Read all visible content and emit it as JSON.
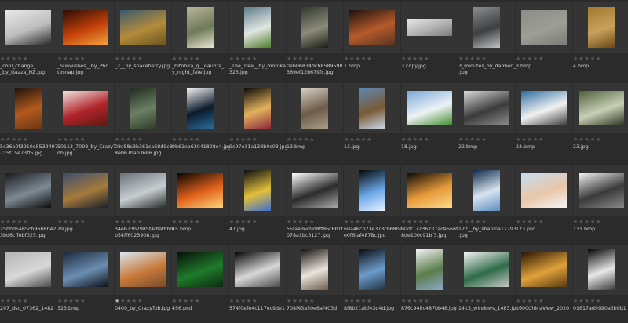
{
  "ui": {
    "accent": "#343434",
    "background": "#2b2b2b",
    "star_empty": "#5a5a5a",
    "star_filled": "#bdbdbd"
  },
  "files": [
    {
      "name": "_cool_change_\n_by_Gazza_NZ.jpg",
      "rating": 0,
      "icon": "tree-silhouette-image",
      "colors": [
        "#e8e8e8",
        "#bdbdbd",
        "#2a2a2a"
      ],
      "thumb_shape": "landscape"
    },
    {
      "name": "_Sunwishes__by_Pho\ntosnap.jpg",
      "rating": 0,
      "icon": "sunset-clouds-image",
      "colors": [
        "#2b0d05",
        "#c4410a",
        "#f3a33a"
      ],
      "thumb_shape": "landscape"
    },
    {
      "name": "_2__by_spaceberry.jpg",
      "rating": 0,
      "icon": "wheat-field-image",
      "colors": [
        "#3b5a6e",
        "#b48b3b",
        "#6a5620"
      ],
      "thumb_shape": "landscape"
    },
    {
      "name": "_hitohira_g__nauhra_\ny_night_fate.jpg",
      "rating": 0,
      "icon": "waterfall-image",
      "colors": [
        "#b9b49a",
        "#6e7a59",
        "#e8e4d0"
      ],
      "thumb_shape": "portrait"
    },
    {
      "name": "_The_Tree__by_moroka\n323.jpg",
      "rating": 0,
      "icon": "lone-tree-image",
      "colors": [
        "#5d7c8a",
        "#e1e6e2",
        "#4f7d2b"
      ],
      "thumb_shape": "portrait"
    },
    {
      "name": "0eb06834dcb8589598\n369ef12b679fc.jpg",
      "rating": 0,
      "icon": "stream-image",
      "colors": [
        "#333a2e",
        "#8c8b7a",
        "#1a1d17"
      ],
      "thumb_shape": "portrait"
    },
    {
      "name": "1.bmp",
      "rating": 0,
      "icon": "dusk-landscape-image",
      "colors": [
        "#1b1210",
        "#b65a2a",
        "#5d3522"
      ],
      "thumb_shape": "landscape"
    },
    {
      "name": "3 copy.jpg",
      "rating": 0,
      "icon": "white-objects-image",
      "colors": [
        "#e9e9e9",
        "#b1b1b1",
        "#7a7a7a"
      ],
      "thumb_shape": "banner"
    },
    {
      "name": "3_minutes_by_damien_c\n.jpg",
      "rating": 0,
      "icon": "clock-tower-image",
      "colors": [
        "#8a8e91",
        "#3c3f40",
        "#c0c3c4"
      ],
      "thumb_shape": "portrait"
    },
    {
      "name": "3.bmp",
      "rating": 0,
      "icon": "grey-texture-image",
      "colors": [
        "#8c8c86",
        "#9e9e98",
        "#7c7c77"
      ],
      "thumb_shape": "landscape"
    },
    {
      "name": "4.bmp",
      "rating": 0,
      "icon": "parchment-image",
      "colors": [
        "#a0782e",
        "#c9a15c",
        "#6b4717"
      ],
      "thumb_shape": "portrait"
    },
    {
      "name": "5c36b0f3910e55324976\n715f15e73ff5.jpg",
      "rating": 0,
      "icon": "violins-image",
      "colors": [
        "#1a120c",
        "#b35a1e",
        "#6d3712"
      ],
      "thumb_shape": "portrait"
    },
    {
      "name": "50112_7098_by_CrazyT\nob.jpg",
      "rating": 0,
      "icon": "red-leaves-image",
      "colors": [
        "#f0e4e0",
        "#b0242a",
        "#5c1a12"
      ],
      "thumb_shape": "landscape"
    },
    {
      "name": "08c58c3b361ca68d9c3\n8e067bab3686.jpg",
      "rating": 0,
      "icon": "green-window-image",
      "colors": [
        "#1e2b1e",
        "#6b8062",
        "#2f3d2a"
      ],
      "thumb_shape": "portrait"
    },
    {
      "name": "9b61ea63041828e4.jpg",
      "rating": 0,
      "icon": "framed-photo-image",
      "colors": [
        "#f4f4f4",
        "#0c1a2a",
        "#2b6c9b"
      ],
      "thumb_shape": "portrait"
    },
    {
      "name": "9c97e31a138b0c03.jpg",
      "rating": 0,
      "icon": "bokeh-lights-image",
      "colors": [
        "#0a0808",
        "#e3b25e",
        "#8c2a3a"
      ],
      "thumb_shape": "portrait"
    },
    {
      "name": "13.bmp",
      "rating": 0,
      "icon": "girl-sitting-image",
      "colors": [
        "#d8d2c2",
        "#6d5b4a",
        "#a99f88"
      ],
      "thumb_shape": "portrait"
    },
    {
      "name": "13.jpg",
      "rating": 0,
      "icon": "wooden-frame-image",
      "colors": [
        "#5e88b4",
        "#7a5a34",
        "#c7d9e8"
      ],
      "thumb_shape": "portrait"
    },
    {
      "name": "18.jpg",
      "rating": 0,
      "icon": "green-hills-image",
      "colors": [
        "#78a8d8",
        "#eef2f6",
        "#3f8a2a"
      ],
      "thumb_shape": "landscape"
    },
    {
      "name": "22.bmp",
      "rating": 0,
      "icon": "pocket-watch-image",
      "colors": [
        "#d9d9d9",
        "#3b3b3b",
        "#8e8e8e"
      ],
      "thumb_shape": "landscape"
    },
    {
      "name": "23.bmp",
      "rating": 0,
      "icon": "teddy-bear-image",
      "colors": [
        "#2b6ca0",
        "#f2f2f2",
        "#3a3a3a"
      ],
      "thumb_shape": "landscape"
    },
    {
      "name": "23.jpg",
      "rating": 0,
      "icon": "forest-path-image",
      "colors": [
        "#4f5e3a",
        "#c7cfb5",
        "#2b3320"
      ],
      "thumb_shape": "landscape"
    },
    {
      "name": "25bbd5a85cb96b8b42\n3bd6cffebf025.jpg",
      "rating": 0,
      "icon": "dark-room-image",
      "colors": [
        "#1a1c1e",
        "#7e8a95",
        "#0d0d0d"
      ],
      "thumb_shape": "landscape"
    },
    {
      "name": "29.jpg",
      "rating": 0,
      "icon": "old-buildings-image",
      "colors": [
        "#3c4e6c",
        "#a57a3c",
        "#1a1f2b"
      ],
      "thumb_shape": "landscape"
    },
    {
      "name": "34eb73b7985f4dfafbbd\nb54ff6025908.jpg",
      "rating": 0,
      "icon": "pyramid-glass-image",
      "colors": [
        "#6a7278",
        "#c8cdd0",
        "#2a2e31"
      ],
      "thumb_shape": "landscape"
    },
    {
      "name": "45.bmp",
      "rating": 0,
      "icon": "fire-night-image",
      "colors": [
        "#0a0503",
        "#e0621b",
        "#ffd27a"
      ],
      "thumb_shape": "landscape"
    },
    {
      "name": "47.jpg",
      "rating": 0,
      "icon": "flowers-dark-image",
      "colors": [
        "#0a0d12",
        "#e2c03a",
        "#3e6ed2"
      ],
      "thumb_shape": "portrait"
    },
    {
      "name": "55faa3ed9d8ff86c6b1f\n078a1bc3127.jpg",
      "rating": 0,
      "icon": "white-figure-image",
      "colors": [
        "#ffffff",
        "#2b2b2b",
        "#a8a8a8"
      ],
      "thumb_shape": "landscape"
    },
    {
      "name": "60a46cb21e373cb68bef\ne0f6faf4878c.jpg",
      "rating": 0,
      "icon": "dandelion-image",
      "colors": [
        "#050608",
        "#6aa8e8",
        "#e8f2ff"
      ],
      "thumb_shape": "portrait"
    },
    {
      "name": "90df17236237ada566f2\n8de100c91bf3.jpg",
      "rating": 0,
      "icon": "window-glow-image",
      "colors": [
        "#0c0906",
        "#e69a3a",
        "#ffd98a"
      ],
      "thumb_shape": "landscape"
    },
    {
      "name": "122__by_shanina12793\n.jpg",
      "rating": 0,
      "icon": "blue-window-image",
      "colors": [
        "#0c2a4a",
        "#d9e4ef",
        "#5b8dbf"
      ],
      "thumb_shape": "portrait"
    },
    {
      "name": "123.psd",
      "rating": 0,
      "icon": "portrait-sky-image",
      "colors": [
        "#c6dcef",
        "#e8c7a8",
        "#f4f4f4"
      ],
      "thumb_shape": "landscape"
    },
    {
      "name": "131.bmp",
      "rating": 0,
      "icon": "butterflies-image",
      "colors": [
        "#f2f2f2",
        "#3a3a3a",
        "#8a8a8a"
      ],
      "thumb_shape": "landscape"
    },
    {
      "name": "297_dsc_07362_1482\n",
      "rating": 0,
      "icon": "stones-water-image",
      "colors": [
        "#b4b4b4",
        "#d8d8d8",
        "#4a4a4a"
      ],
      "thumb_shape": "landscape"
    },
    {
      "name": "323.bmp",
      "rating": 0,
      "icon": "city-night-image",
      "colors": [
        "#1d2a3a",
        "#6b8eb3",
        "#0c0f14"
      ],
      "thumb_shape": "landscape"
    },
    {
      "name": "0409_by_CrazyTob.jpg",
      "rating": 1,
      "icon": "blossom-branch-image",
      "colors": [
        "#d8e6f2",
        "#c87a3a",
        "#7a4a2a"
      ],
      "thumb_shape": "landscape"
    },
    {
      "name": "456.psd",
      "rating": 0,
      "icon": "green-matrix-image",
      "colors": [
        "#071207",
        "#1f7a2a",
        "#0c2b0f"
      ],
      "thumb_shape": "landscape"
    },
    {
      "name": "574f0efe4c117ec9de1\n",
      "rating": 0,
      "icon": "dark-lamps-image",
      "colors": [
        "#060606",
        "#d8d8d8",
        "#4a4a4a"
      ],
      "thumb_shape": "landscape"
    },
    {
      "name": "708f43a50e6af403d\n",
      "rating": 0,
      "icon": "arch-window-image",
      "colors": [
        "#1a1410",
        "#e9e4dc",
        "#6b5a48"
      ],
      "thumb_shape": "portrait"
    },
    {
      "name": "8f8b21abf43d4d.jpg",
      "rating": 0,
      "icon": "gothic-window-image",
      "colors": [
        "#0a0c10",
        "#6c9ccc",
        "#22303f"
      ],
      "thumb_shape": "portrait"
    },
    {
      "name": "876c948c487bb48.jpg",
      "rating": 0,
      "icon": "pier-image",
      "colors": [
        "#f2f2f2",
        "#5a7d4a",
        "#8aa8c8"
      ],
      "thumb_shape": "portrait"
    },
    {
      "name": "1413_windows_1483.jpg",
      "rating": 0,
      "icon": "green-shutters-image",
      "colors": [
        "#f2f2f0",
        "#2e6b4a",
        "#c9c9c4"
      ],
      "thumb_shape": "landscape"
    },
    {
      "name": "1600ChinaView_2020\n",
      "rating": 0,
      "icon": "golden-river-image",
      "colors": [
        "#2a1606",
        "#e0a23a",
        "#5a3a12"
      ],
      "thumb_shape": "landscape"
    },
    {
      "name": "01617ad9990a5b9b1\n",
      "rating": 0,
      "icon": "dark-alley-image",
      "colors": [
        "#050505",
        "#e8e8e8",
        "#3a3a3a"
      ],
      "thumb_shape": "portrait"
    }
  ]
}
